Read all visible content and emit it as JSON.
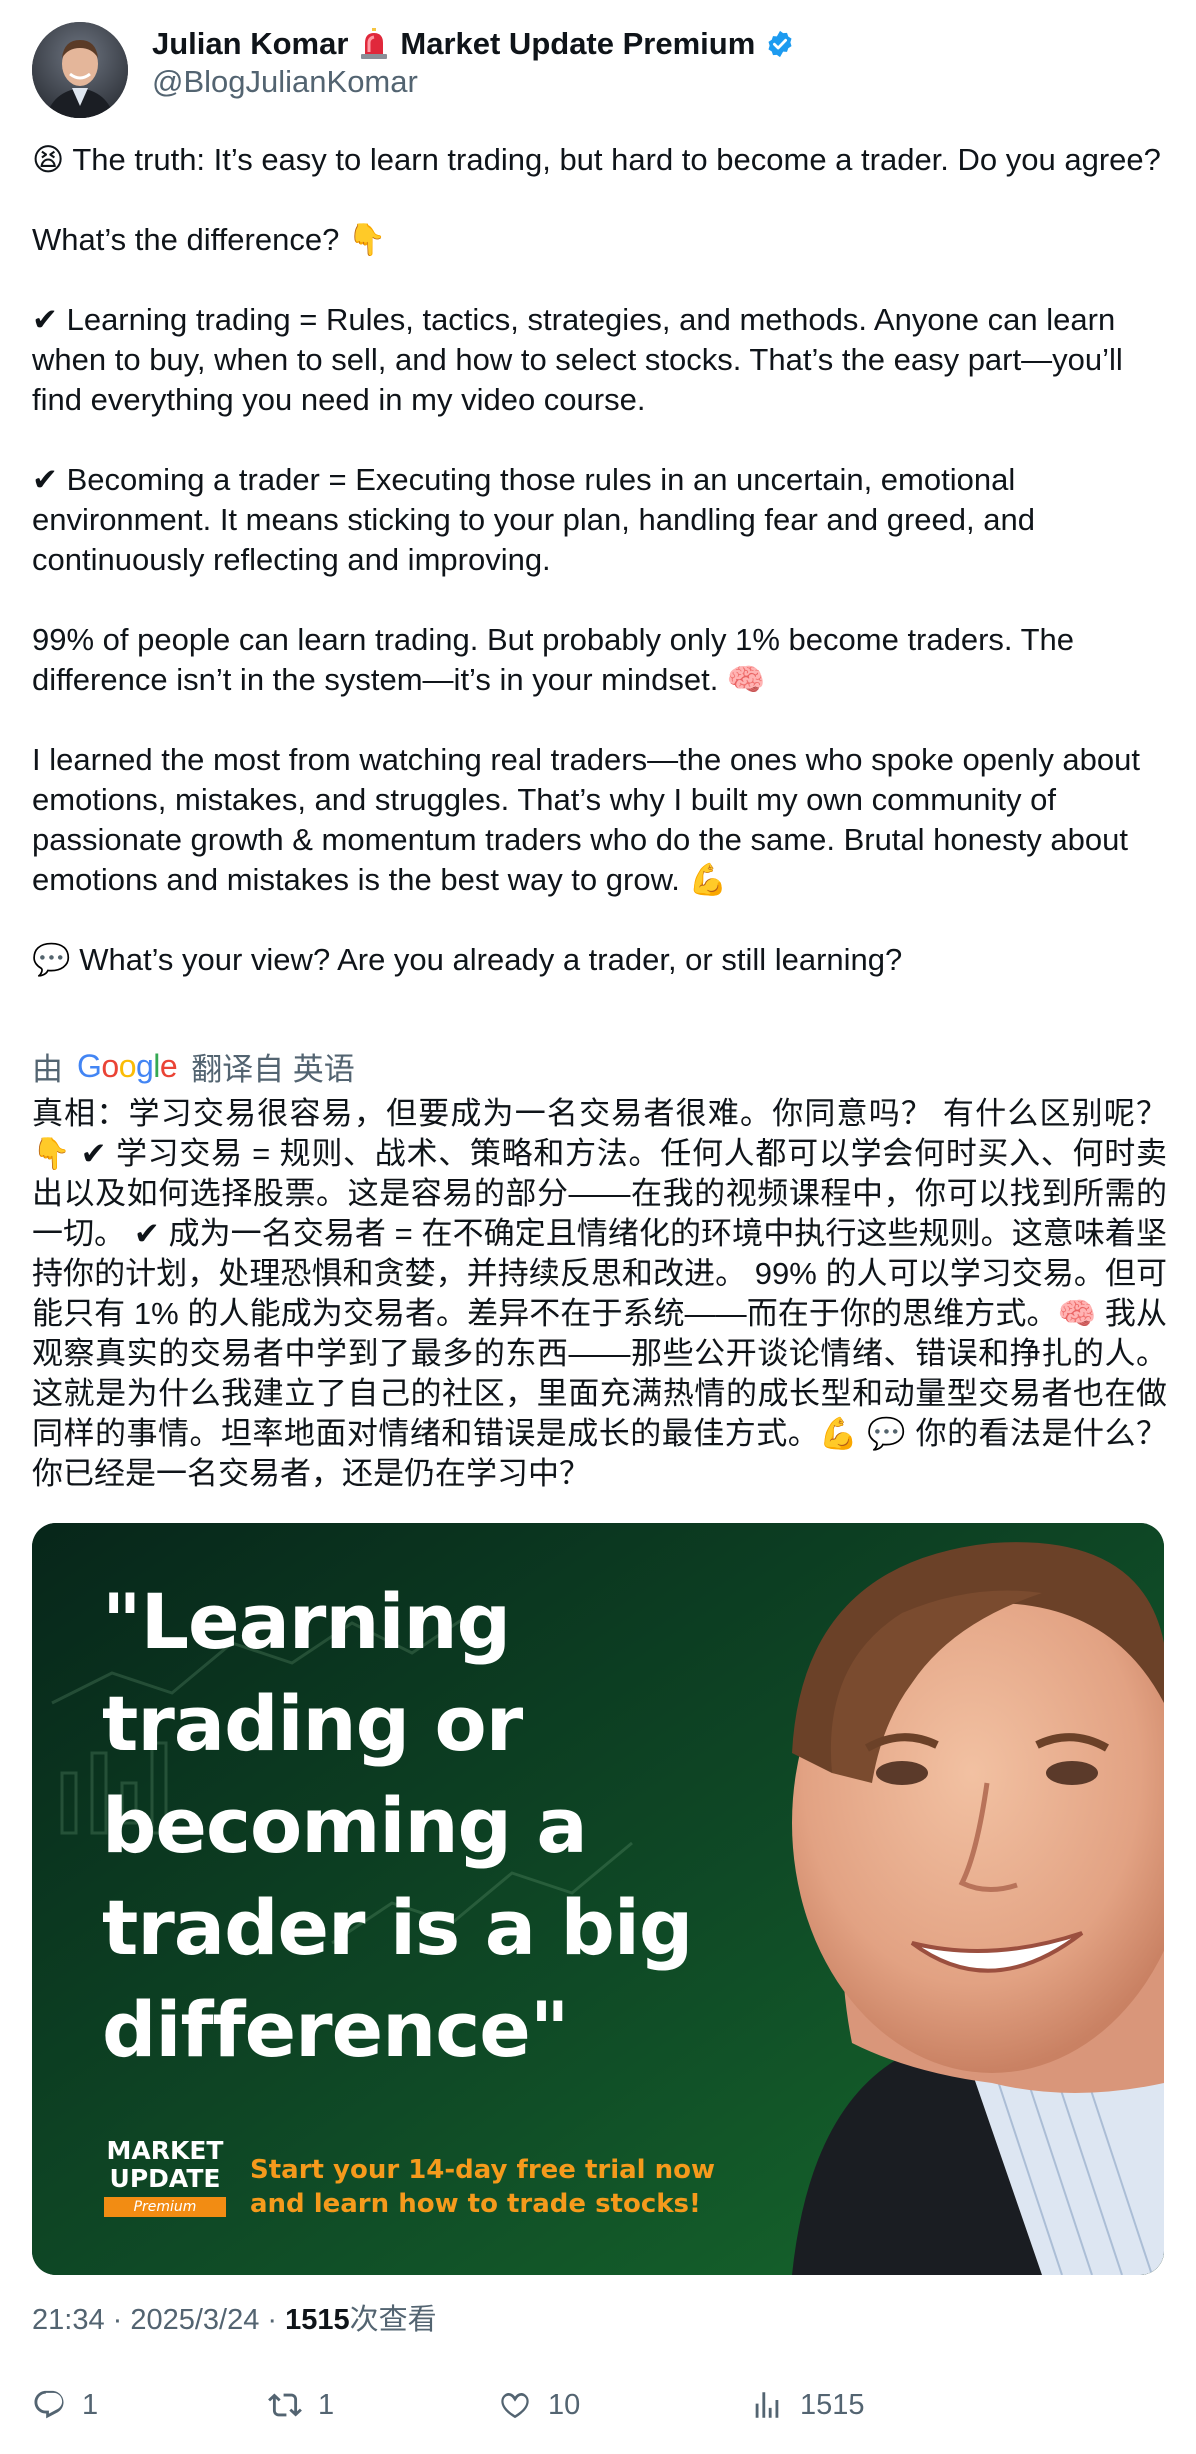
{
  "author": {
    "name": "Julian Komar",
    "title_suffix": "Market Update Premium",
    "handle": "@BlogJulianKomar",
    "verified_color": "#1d9bf0"
  },
  "tweet": {
    "paragraphs": [
      "😫 The truth: It’s easy to learn trading, but hard to become a trader. Do you agree?",
      "What’s the difference? 👇",
      "✔ Learning trading = Rules, tactics, strategies, and methods. Anyone can learn when to buy, when to sell, and how to select stocks. That’s the easy part—you’ll find everything you need in my video course.",
      "✔ Becoming a trader = Executing those rules in an uncertain, emotional environment. It means sticking to your plan, handling fear and greed, and continuously reflecting and improving.",
      "99% of people can learn trading. But probably only 1% become traders. The difference isn’t in the system—it’s in your mindset. 🧠",
      "I learned the most from watching real traders—the ones who spoke openly about emotions, mistakes, and struggles. That’s why I built my own community of passionate growth & momentum traders who do the same. Brutal honesty about emotions and mistakes is the best way to grow. 💪",
      "💬 What’s your view? Are you already a trader, or still learning?"
    ]
  },
  "translation": {
    "by": "由",
    "provider": "Google",
    "from_label": "翻译自 英语",
    "text": "真相：学习交易很容易，但要成为一名交易者很难。你同意吗？ 有什么区别呢？ 👇 ✔ 学习交易 = 规则、战术、策略和方法。任何人都可以学会何时买入、何时卖出以及如何选择股票。这是容易的部分——在我的视频课程中，你可以找到所需的一切。 ✔ 成为一名交易者 = 在不确定且情绪化的环境中执行这些规则。这意味着坚持你的计划，处理恐惧和贪婪，并持续反思和改进。 99% 的人可以学习交易。但可能只有 1% 的人能成为交易者。差异不在于系统——而在于你的思维方式。🧠 我从观察真实的交易者中学到了最多的东西——那些公开谈论情绪、错误和挣扎的人。这就是为什么我建立了自己的社区，里面充满热情的成长型和动量型交易者也在做同样的事情。坦率地面对情绪和错误是成长的最佳方式。💪 💬 你的看法是什么？你已经是一名交易者，还是仍在学习中？"
  },
  "media": {
    "quote_lines": [
      "\"Learning",
      "trading or",
      "becoming a",
      "trader is a big",
      "difference\""
    ],
    "logo_line1": "MARKET",
    "logo_line2": "UPDATE",
    "logo_premium": "Premium",
    "cta_line1": "Start your 14-day free trial now",
    "cta_line2": "and learn how to trade stocks!",
    "accent_color": "#f59a1c"
  },
  "meta": {
    "time": "21:34",
    "date": "2025/3/24",
    "views_count": "1515",
    "views_label": "次查看"
  },
  "actions": {
    "replies": "1",
    "reposts": "1",
    "likes": "10",
    "views": "1515"
  }
}
